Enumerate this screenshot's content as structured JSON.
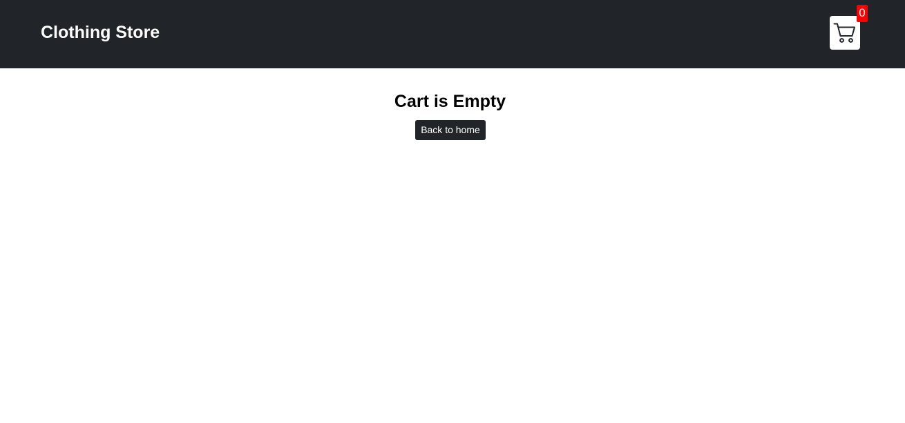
{
  "navbar": {
    "brand": "Clothing Store",
    "cart": {
      "icon": "cart-icon",
      "count": "0",
      "badge_color": "#ff0000"
    },
    "background_color": "#212529"
  },
  "main": {
    "title": "Cart is Empty",
    "back_button_label": "Back to home"
  }
}
